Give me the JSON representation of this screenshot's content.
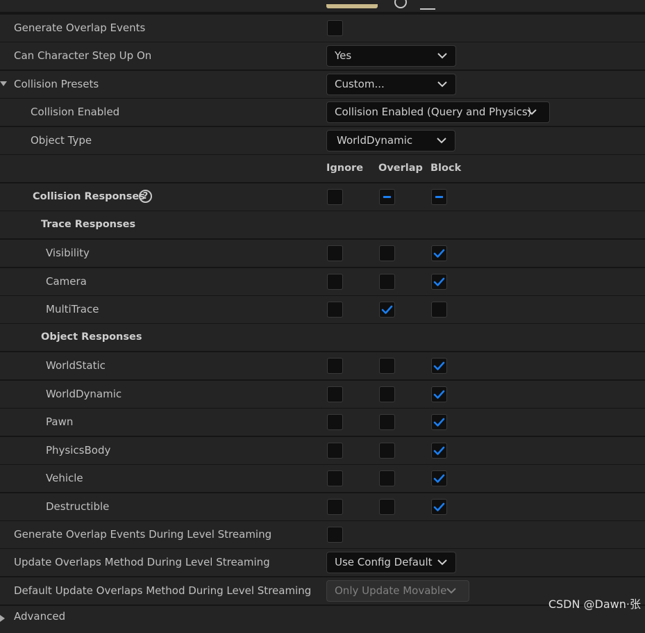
{
  "colors": {
    "accent": "#1a7ef2",
    "panel_bg": "#242424",
    "divider": "#151515"
  },
  "rows": {
    "generate_overlap": {
      "label": "Generate Overlap Events"
    },
    "step_up": {
      "label": "Can Character Step Up On",
      "value": "Yes"
    },
    "presets": {
      "label": "Collision Presets",
      "value": "Custom..."
    },
    "collision_enabled": {
      "label": "Collision Enabled",
      "value": "Collision Enabled (Query and Physics)"
    },
    "object_type": {
      "label": "Object Type",
      "value": "WorldDynamic"
    },
    "columns": {
      "ignore": "Ignore",
      "overlap": "Overlap",
      "block": "Block"
    },
    "collision_responses": {
      "label": "Collision Responses",
      "help_glyph": "?"
    },
    "trace_responses": {
      "label": "Trace Responses"
    },
    "trace_items": [
      {
        "label": "Visibility",
        "state": "block"
      },
      {
        "label": "Camera",
        "state": "block"
      },
      {
        "label": "MultiTrace",
        "state": "overlap"
      }
    ],
    "object_responses": {
      "label": "Object Responses"
    },
    "object_items": [
      {
        "label": "WorldStatic",
        "state": "block"
      },
      {
        "label": "WorldDynamic",
        "state": "block"
      },
      {
        "label": "Pawn",
        "state": "block"
      },
      {
        "label": "PhysicsBody",
        "state": "block"
      },
      {
        "label": "Vehicle",
        "state": "block"
      },
      {
        "label": "Destructible",
        "state": "block"
      }
    ],
    "gen_overlap_streaming": {
      "label": "Generate Overlap Events During Level Streaming"
    },
    "update_overlaps": {
      "label": "Update Overlaps Method During Level Streaming",
      "value": "Use Config Default"
    },
    "default_update_overlaps": {
      "label": "Default Update Overlaps Method During Level Streaming",
      "value": "Only Update Movable"
    },
    "advanced": {
      "label": "Advanced"
    }
  },
  "watermark": "CSDN @Dawn·张"
}
